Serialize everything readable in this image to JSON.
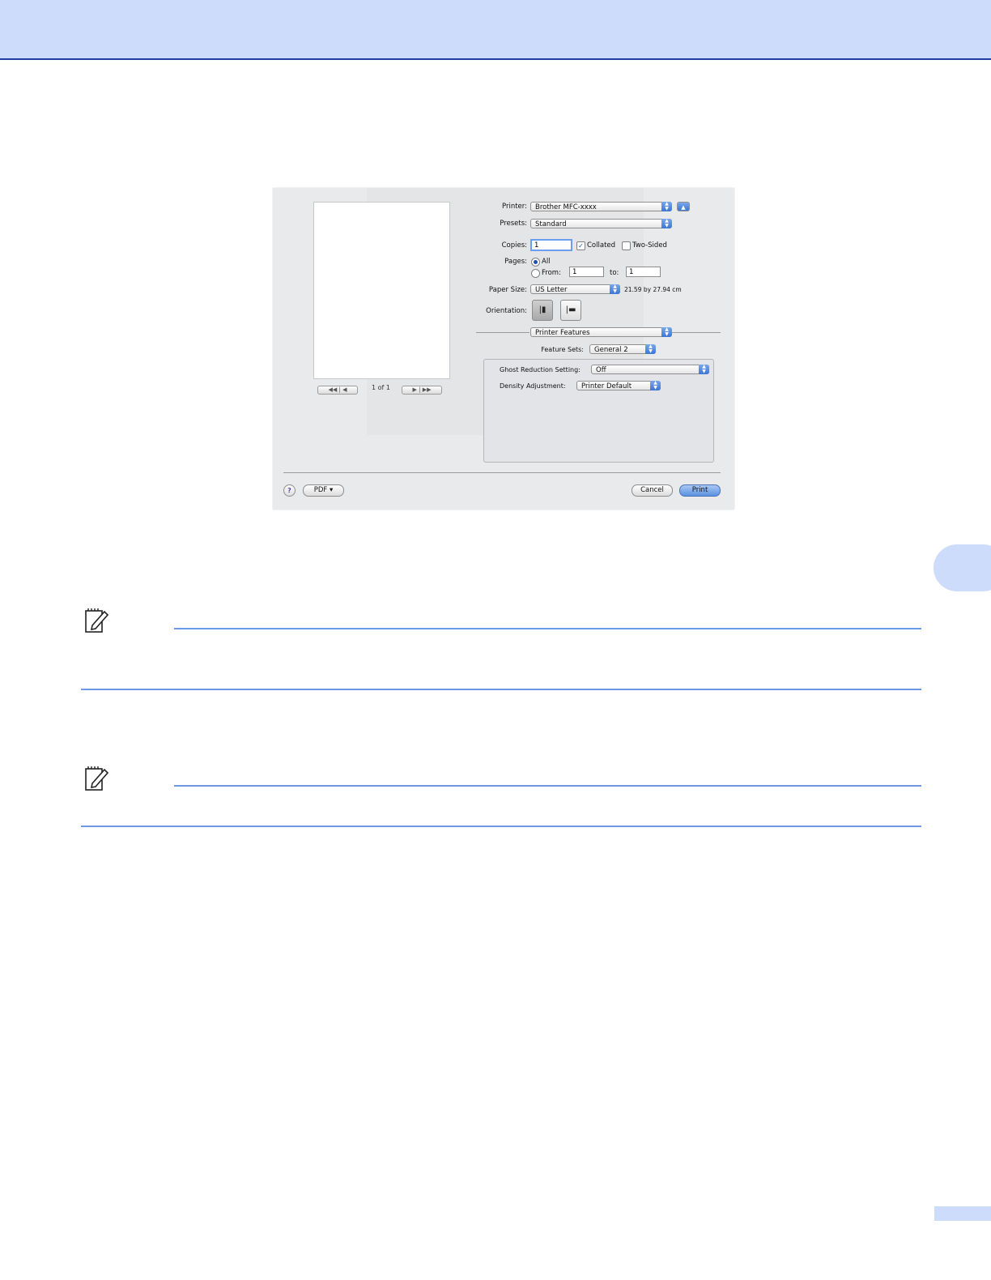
{
  "dialog": {
    "printer_label": "Printer:",
    "printer_value": "Brother MFC-xxxx",
    "presets_label": "Presets:",
    "presets_value": "Standard",
    "copies_label": "Copies:",
    "copies_value": "1",
    "collated_label": "Collated",
    "collated_checked": true,
    "two_sided_label": "Two-Sided",
    "two_sided_checked": false,
    "pages_label": "Pages:",
    "all_label": "All",
    "from_label": "From:",
    "from_value": "1",
    "to_label": "to:",
    "to_value": "1",
    "paper_size_label": "Paper Size:",
    "paper_size_value": "US Letter",
    "paper_size_dims": "21.59 by 27.94 cm",
    "orientation_label": "Orientation:",
    "section_value": "Printer Features",
    "feature_sets_label": "Feature Sets:",
    "feature_sets_value": "General 2",
    "ghost_label": "Ghost Reduction Setting:",
    "ghost_value": "Off",
    "density_label": "Density Adjustment:",
    "density_value": "Printer Default",
    "page_count": "1 of 1",
    "pdf_label": "PDF ▾",
    "cancel_label": "Cancel",
    "print_label": "Print",
    "help_label": "?"
  },
  "icons": [
    "note-pencil-icon",
    "help-icon",
    "portrait-icon",
    "landscape-icon",
    "disclosure-up-icon"
  ]
}
